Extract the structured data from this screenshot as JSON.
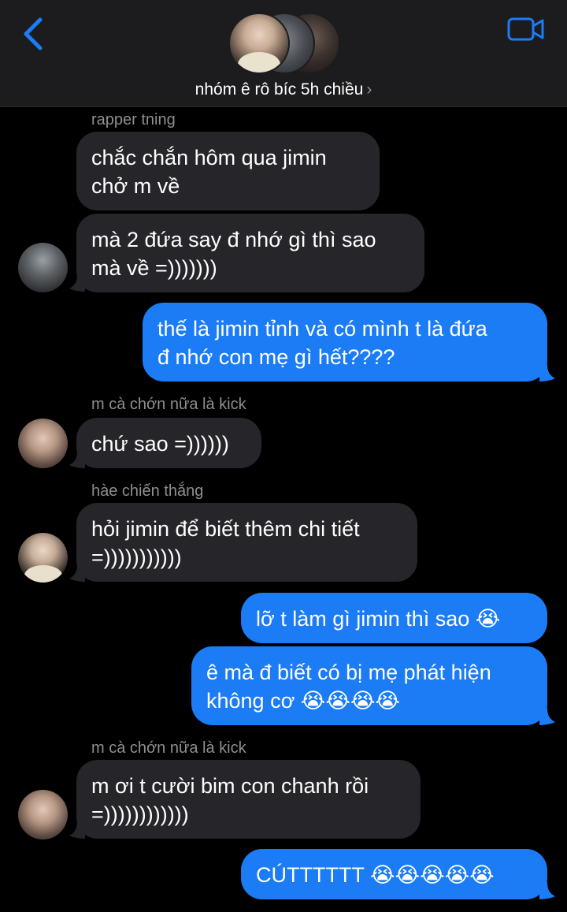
{
  "header": {
    "group_name": "nhóm ê rô bíc 5h chiều",
    "chevron": "›",
    "back_icon": "chevron-left-icon",
    "video_icon": "video-camera-icon",
    "accent_color": "#1b7cf5"
  },
  "messages": [
    {
      "sender": "rapper tning",
      "text": "chắc chắn hôm qua jimin\nchở m về"
    },
    {
      "text": "mà 2 đứa say đ nhớ gì thì sao\nmà về =)))))))"
    },
    {
      "text": "thế là jimin tỉnh và có mình t là đứa\nđ nhớ con mẹ gì hết????"
    },
    {
      "sender": "m cà chớn nữa là kick",
      "text": "chứ sao =))))))"
    },
    {
      "sender": "hàe chiến thắng",
      "text": "hỏi jimin để biết thêm chi tiết\n=)))))))))))"
    },
    {
      "text": "lỡ t làm gì jimin thì sao 😭"
    },
    {
      "text": "ê mà đ biết có bị mẹ phát hiện\nkhông cơ 😭😭😭😭"
    },
    {
      "sender": "m cà chớn nữa là kick",
      "text": "m ơi t cười bim con chanh rồi\n=))))))))))))"
    },
    {
      "text": "CÚTTTTTT 😭😭😭😭😭"
    }
  ],
  "colors": {
    "incoming_bubble": "#26252a",
    "outgoing_bubble": "#1b7cf5",
    "sender_label": "#8e8e93",
    "background": "#000000"
  }
}
